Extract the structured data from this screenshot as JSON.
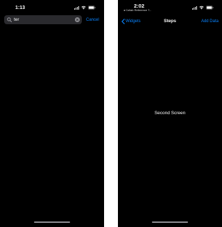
{
  "left_screen": {
    "status_bar": {
      "time": "1:13"
    },
    "search": {
      "value": "ter",
      "cancel_label": "Cancel"
    }
  },
  "right_screen": {
    "status_bar": {
      "time": "2:02",
      "back_app": "◂ Collab Reference T..."
    },
    "nav": {
      "back_label": "Widgets",
      "title": "Steps",
      "action_label": "Add Data"
    },
    "content": {
      "center_text": "Second Screen"
    }
  },
  "colors": {
    "background": "#000000",
    "accent": "#0a84ff",
    "search_field": "#2a2a2e",
    "text": "#ffffff"
  },
  "icons": [
    "signal-icon",
    "wifi-icon",
    "battery-icon",
    "search-icon",
    "clear-icon",
    "chevron-left-icon"
  ]
}
